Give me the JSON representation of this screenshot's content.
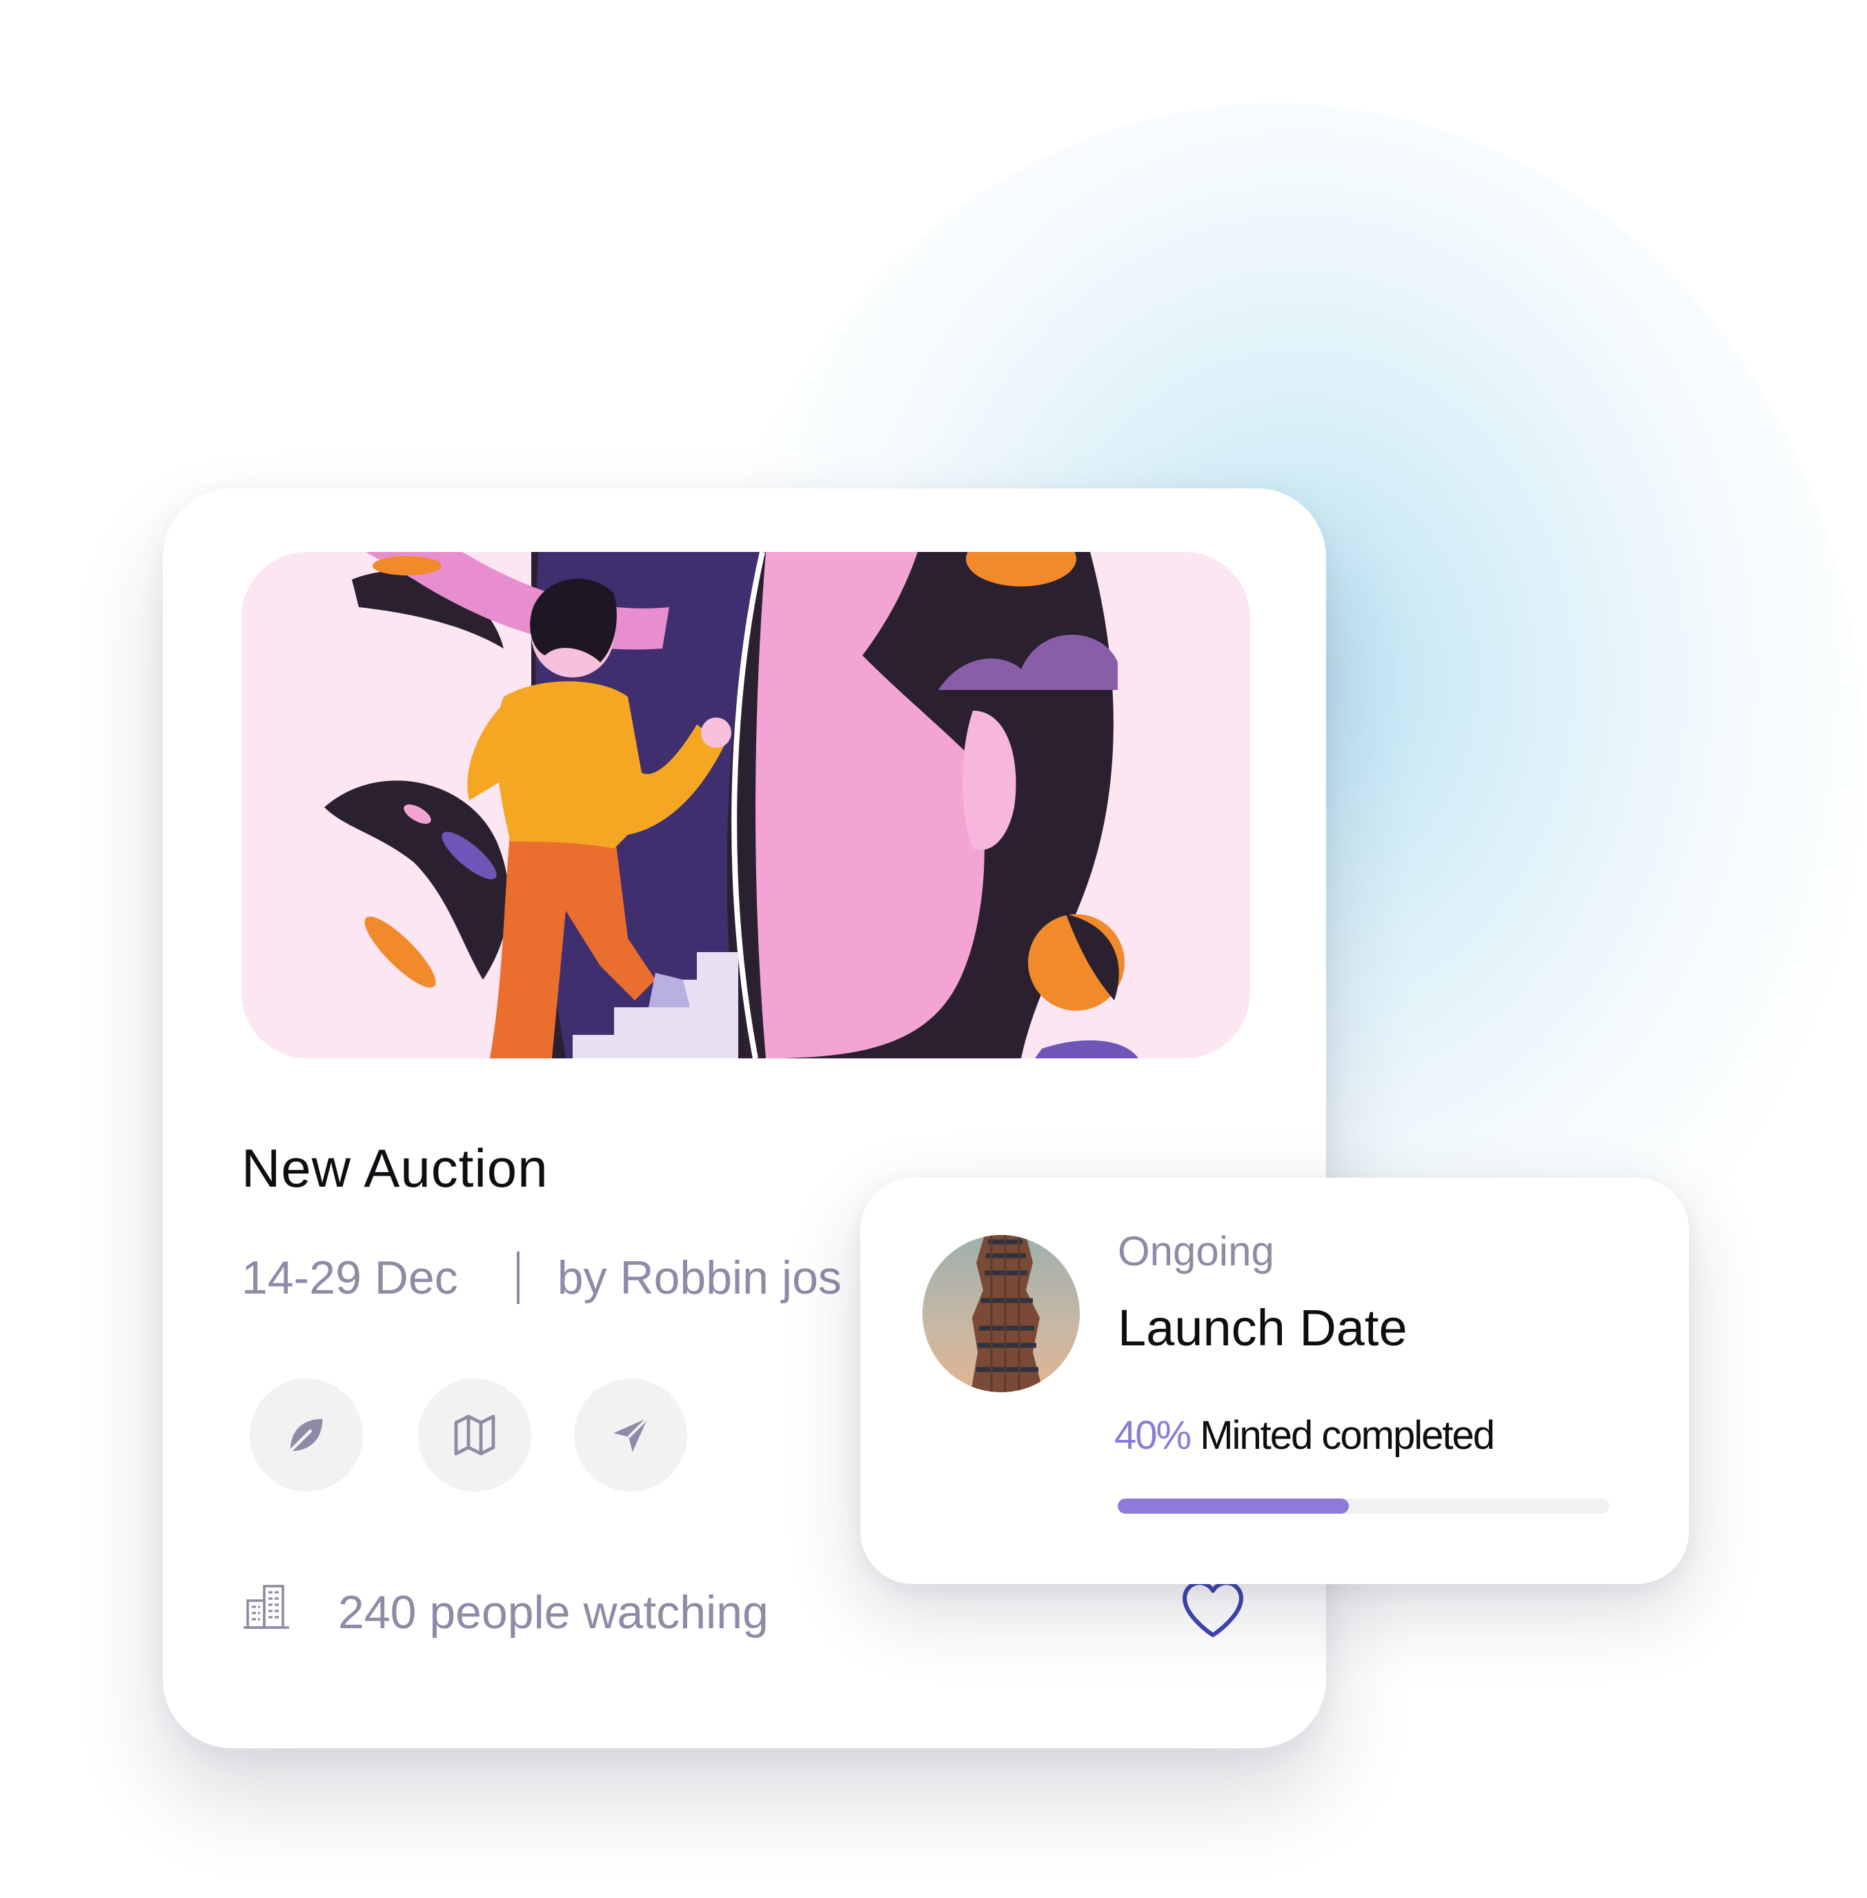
{
  "card": {
    "title": "New Auction",
    "date": "14-29 Dec",
    "author": "by Robbin jos",
    "actions": [
      {
        "icon": "leaf-icon"
      },
      {
        "icon": "map-icon"
      },
      {
        "icon": "send-icon"
      }
    ],
    "watching": "240 people watching",
    "building_icon": "building-icon",
    "heart_icon": "heart-icon"
  },
  "launch": {
    "status": "Ongoing",
    "title": "Launch Date",
    "percent": "40%",
    "progress_label": "Minted completed",
    "progress_fraction": 0.47
  },
  "colors": {
    "accent": "#8e7ad8",
    "muted_text": "#8f8aa6",
    "heart": "#3b46b0",
    "icon_bg": "#f2f2f3"
  }
}
